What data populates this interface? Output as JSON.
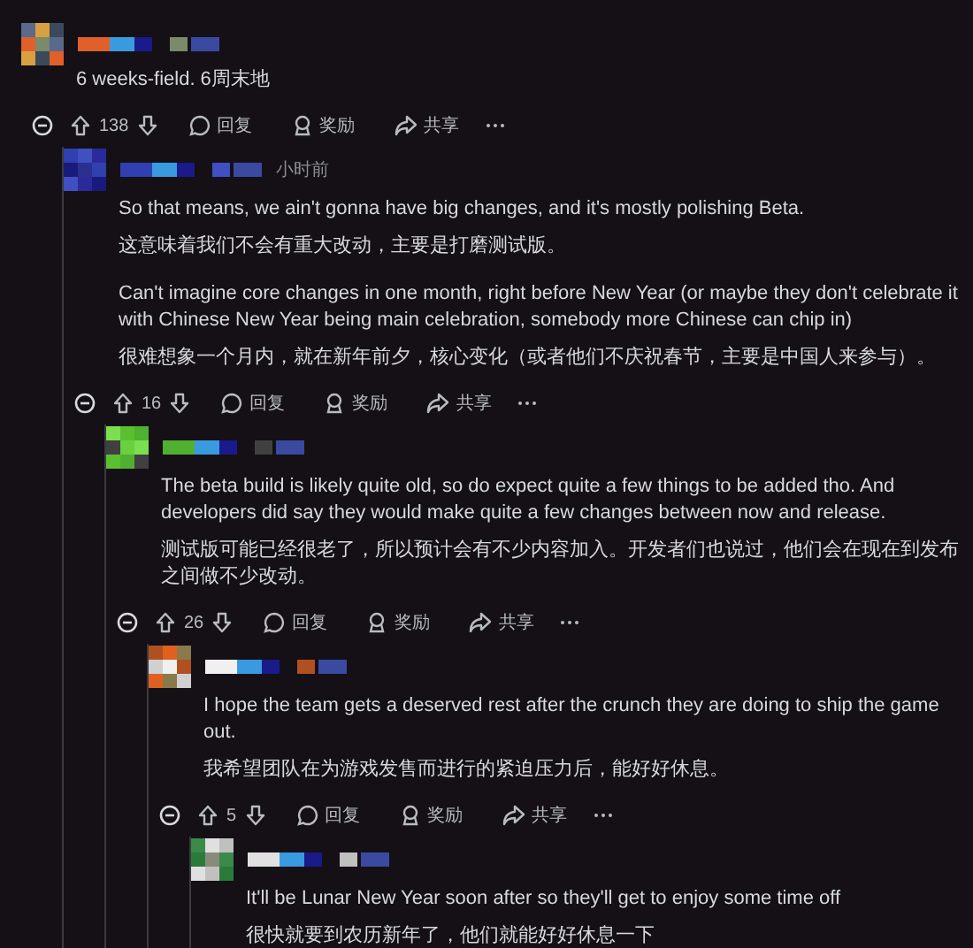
{
  "comments": [
    {
      "groups": [
        [
          "6 weeks-field.  6周末地"
        ]
      ],
      "actions": {
        "votes": "138",
        "reply": "回复",
        "award": "奖励",
        "share": "共享"
      },
      "children": [
        {
          "time": "小时前",
          "groups": [
            [
              "So that means, we ain't gonna have big changes, and it's mostly polishing Beta.",
              "这意味着我们不会有重大改动，主要是打磨测试版。"
            ],
            [
              "Can't imagine core changes in one month, right before New Year (or maybe they don't celebrate it with Chinese New Year being main celebration, somebody more Chinese can chip in)",
              "很难想象一个月内，就在新年前夕，核心变化（或者他们不庆祝春节，主要是中国人来参与）。"
            ]
          ],
          "actions": {
            "votes": "16",
            "reply": "回复",
            "award": "奖励",
            "share": "共享"
          },
          "children": [
            {
              "groups": [
                [
                  "The beta build is likely quite old, so do expect quite a few things to be added tho. And developers did say they would make quite a few changes between now and release.",
                  "测试版可能已经很老了，所以预计会有不少内容加入。开发者们也说过，他们会在现在到发布之间做不少改动。"
                ]
              ],
              "actions": {
                "votes": "26",
                "reply": "回复",
                "award": "奖励",
                "share": "共享"
              },
              "children": [
                {
                  "groups": [
                    [
                      "I hope the team gets a deserved rest after the crunch they are doing to ship the game out.",
                      "我希望团队在为游戏发售而进行的紧迫压力后，能好好休息。"
                    ]
                  ],
                  "actions": {
                    "votes": "5",
                    "reply": "回复",
                    "award": "奖励",
                    "share": "共享"
                  },
                  "children": [
                    {
                      "groups": [
                        [
                          "It'll be Lunar New Year soon after so they'll get to enjoy some time off",
                          "很快就要到农历新年了，他们就能好好休息一下"
                        ]
                      ]
                    }
                  ]
                }
              ]
            }
          ]
        }
      ]
    }
  ]
}
